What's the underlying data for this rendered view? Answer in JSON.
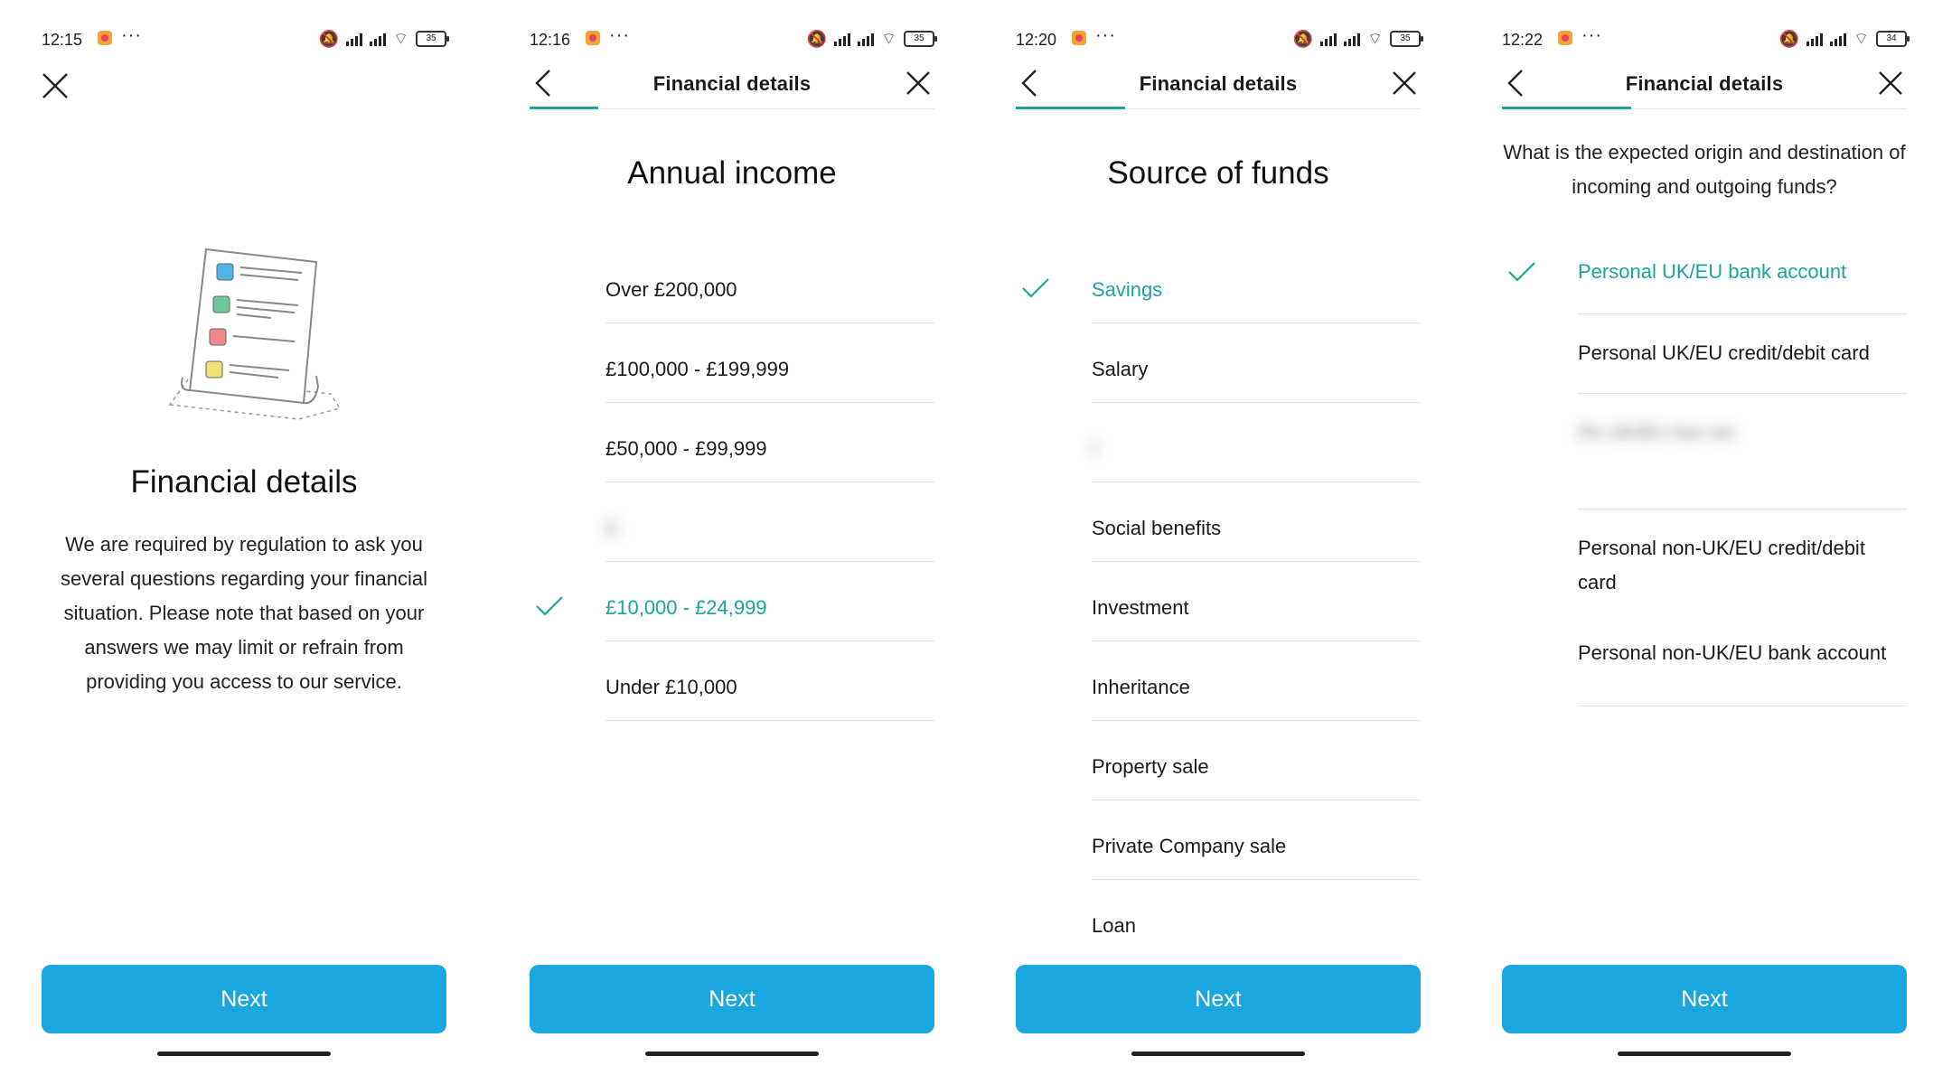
{
  "screens": [
    {
      "status": {
        "time": "12:15",
        "battery": "35"
      },
      "title": "Financial details",
      "body": "We are required by regulation to ask you several questions regarding your financial situation. Please note that based on your answers we may limit or refrain from providing you access to our service.",
      "next_label": "Next"
    },
    {
      "status": {
        "time": "12:16",
        "battery": "35"
      },
      "header_title": "Financial details",
      "progress_fraction": 0.17,
      "heading": "Annual income",
      "options": [
        {
          "label": "Over £200,000",
          "selected": false
        },
        {
          "label": "£100,000 - £199,999",
          "selected": false
        },
        {
          "label": "£50,000 - £99,999",
          "selected": false
        },
        {
          "label": "£:",
          "selected": false,
          "obscured": true
        },
        {
          "label": "£10,000 - £24,999",
          "selected": true
        },
        {
          "label": "Under £10,000",
          "selected": false
        }
      ],
      "next_label": "Next"
    },
    {
      "status": {
        "time": "12:20",
        "battery": "35"
      },
      "header_title": "Financial details",
      "progress_fraction": 0.27,
      "heading": "Source of funds",
      "options": [
        {
          "label": "Savings",
          "selected": true
        },
        {
          "label": "Salary",
          "selected": false
        },
        {
          "label": "I",
          "selected": false,
          "obscured": true
        },
        {
          "label": "Social benefits",
          "selected": false
        },
        {
          "label": "Investment",
          "selected": false
        },
        {
          "label": "Inheritance",
          "selected": false
        },
        {
          "label": "Property sale",
          "selected": false
        },
        {
          "label": "Private Company sale",
          "selected": false
        },
        {
          "label": "Loan",
          "selected": false
        }
      ],
      "next_label": "Next"
    },
    {
      "status": {
        "time": "12:22",
        "battery": "34"
      },
      "header_title": "Financial details",
      "progress_fraction": 0.32,
      "question": "What is the expected origin and destination of incoming and outgoing funds?",
      "options": [
        {
          "label": "Personal UK/EU bank account",
          "selected": true
        },
        {
          "label": "Personal UK/EU credit/debit card",
          "selected": false
        },
        {
          "label": "Pe UK/EU lice ion",
          "selected": false,
          "obscured": true
        },
        {
          "label": "Personal non-UK/EU credit/debit card",
          "selected": false
        },
        {
          "label": "Personal non-UK/EU bank account",
          "selected": false
        }
      ],
      "next_label": "Next"
    }
  ],
  "colors": {
    "accent_teal": "#1ba39c",
    "button_blue": "#1aa7e0",
    "divider": "#e4e4e4"
  },
  "icons": {
    "close": "close-icon",
    "back": "chevron-left-icon",
    "check": "check-icon"
  }
}
